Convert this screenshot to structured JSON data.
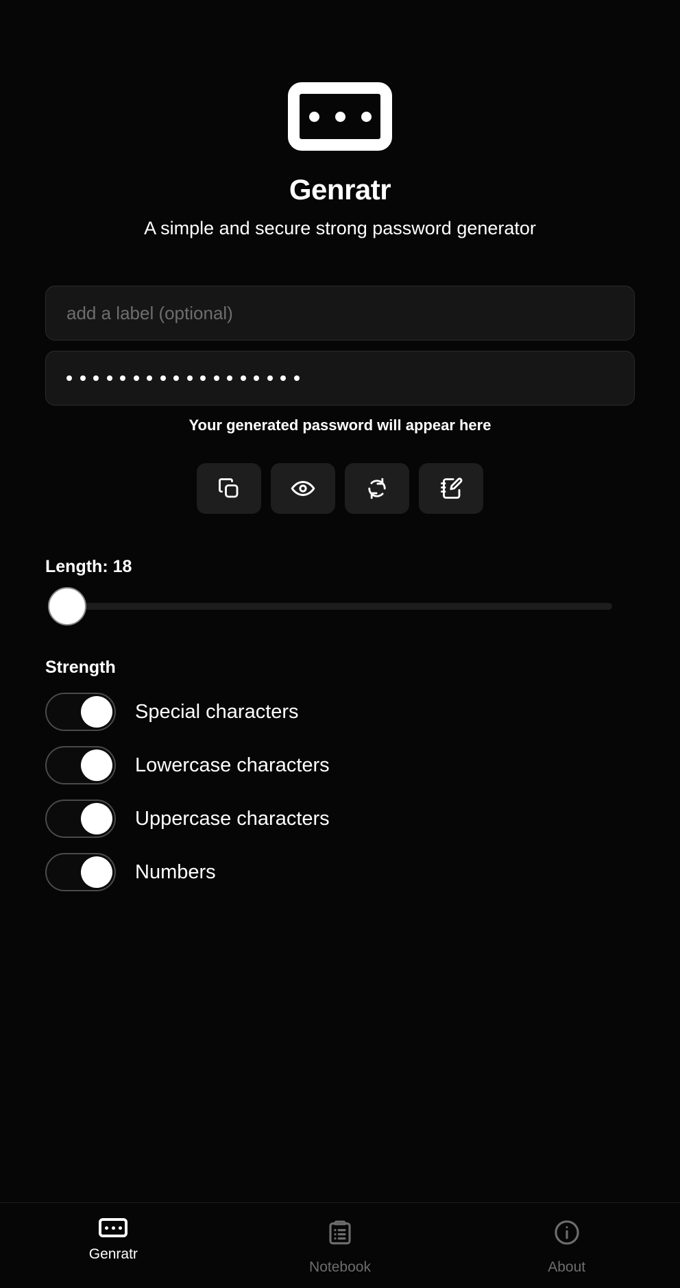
{
  "app": {
    "title": "Genratr",
    "subtitle": "A simple and secure strong password generator",
    "logo_icon": "password-dots-icon",
    "logo_dot_count": 3
  },
  "form": {
    "label_input": {
      "placeholder": "add a label (optional)",
      "value": ""
    },
    "password_output": {
      "masked": true,
      "mask_dot_count": 18,
      "value": "",
      "helper_text": "Your generated password will appear here"
    }
  },
  "actions": [
    {
      "name": "copy-button",
      "icon": "copy-icon",
      "label": "Copy"
    },
    {
      "name": "reveal-button",
      "icon": "eye-icon",
      "label": "Show password"
    },
    {
      "name": "regenerate-button",
      "icon": "refresh-icon",
      "label": "Regenerate"
    },
    {
      "name": "save-to-notebook-button",
      "icon": "notebook-edit-icon",
      "label": "Save to notebook"
    }
  ],
  "length": {
    "label": "Length: 18",
    "value": 18,
    "slider_position_percent": 0
  },
  "strength": {
    "label": "Strength",
    "options": [
      {
        "label": "Special characters",
        "enabled": true
      },
      {
        "label": "Lowercase characters",
        "enabled": true
      },
      {
        "label": "Uppercase characters",
        "enabled": true
      },
      {
        "label": "Numbers",
        "enabled": true
      }
    ]
  },
  "bottom_nav": {
    "items": [
      {
        "label": "Genratr",
        "icon": "password-dots-icon",
        "active": true
      },
      {
        "label": "Notebook",
        "icon": "clipboard-list-icon",
        "active": false
      },
      {
        "label": "About",
        "icon": "info-circle-icon",
        "active": false
      }
    ]
  },
  "colors": {
    "background": "#060606",
    "surface": "#161616",
    "button_surface": "#1e1e1e",
    "accent": "#ffffff",
    "muted_text": "#6d6d6d",
    "placeholder_text": "#6e6e6e",
    "border": "#2b2b2b"
  }
}
